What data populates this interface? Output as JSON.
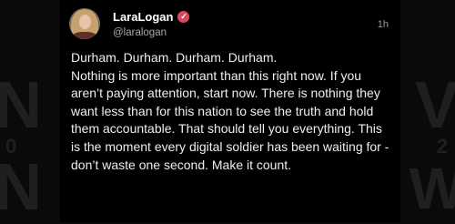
{
  "post": {
    "display_name": "LaraLogan",
    "handle": "@laralogan",
    "time": "1h",
    "verified_icon": "verified-badge-icon",
    "text": "Durham. Durham. Durham. Durham.\nNothing is more important than this right now. If you aren’t paying attention, start now. There is nothing they want less than for this nation to see the truth and hold them accountable. That should tell you everything. This is the moment every digital soldier has been waiting for - don’t waste one second. Make it count."
  },
  "background_lettering": {
    "left_top": "N",
    "left_bottom": "N",
    "left_mid": "0",
    "right_top": "V",
    "right_bottom": "W",
    "right_mid": "2"
  },
  "colors": {
    "background": "#0a0a0a",
    "card": "#000000",
    "verified": "#d9465f"
  }
}
